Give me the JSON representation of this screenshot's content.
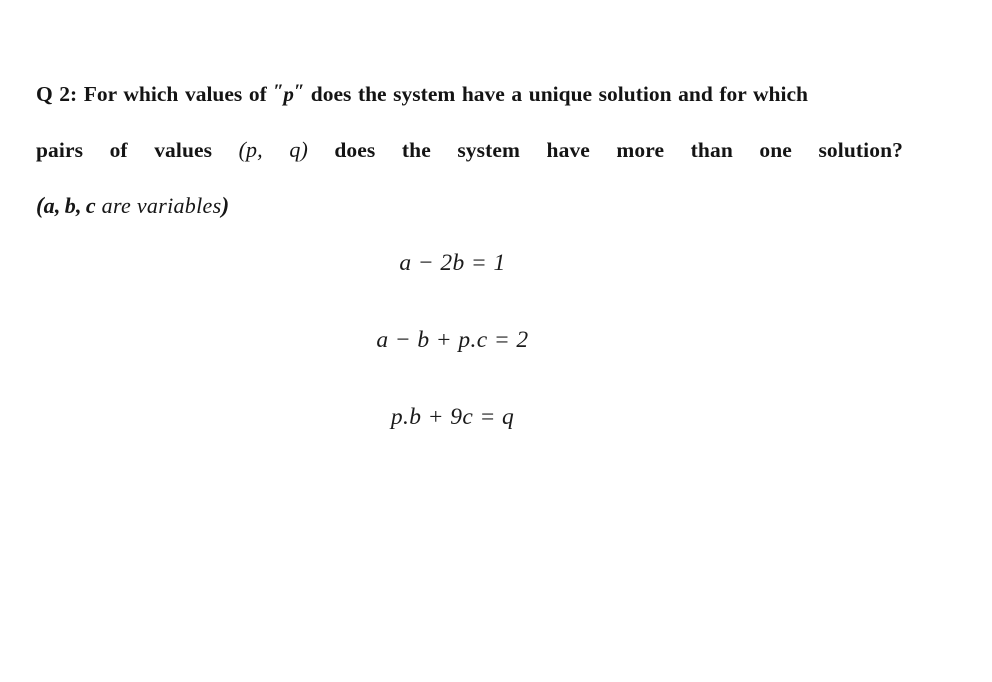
{
  "document": {
    "page_background": "#ffffff",
    "text_color": "#161616",
    "question_label": "Q 2:",
    "prose": {
      "line1_before_var": "For which values of",
      "line1_quoted_variable": "p",
      "line1_after_var": "does the system have a unique solution and for which",
      "line2_words": [
        "pairs",
        "of",
        "values"
      ],
      "line2_pair": "(p, q)",
      "line2_words_after": [
        "does",
        "the",
        "system",
        "have",
        "more",
        "than",
        "one",
        "solution?"
      ],
      "line2_full": "pairs of values (p, q) does the system have more than one solution?",
      "variables_note": {
        "open_paren": "(",
        "variables": [
          "a",
          "b",
          "c"
        ],
        "separator": ", ",
        "words": " are variables",
        "close_paren": ")",
        "full": "(a, b, c are variables)"
      }
    },
    "equations": [
      {
        "id": "eq1",
        "display": "a − 2b = 1",
        "lhs": "a − 2b",
        "rhs": "1",
        "terms": [
          {
            "coefficient": "1",
            "variable": "a",
            "sign": "+"
          },
          {
            "coefficient": "2",
            "variable": "b",
            "sign": "−"
          }
        ],
        "constant": "1"
      },
      {
        "id": "eq2",
        "display": "a − b + p.c = 2",
        "lhs": "a − b + p.c",
        "rhs": "2",
        "terms": [
          {
            "coefficient": "1",
            "variable": "a",
            "sign": "+"
          },
          {
            "coefficient": "1",
            "variable": "b",
            "sign": "−"
          },
          {
            "coefficient": "p",
            "variable": "c",
            "sign": "+"
          }
        ],
        "constant": "2"
      },
      {
        "id": "eq3",
        "display": "p.b + 9c = q",
        "lhs": "p.b + 9c",
        "rhs": "q",
        "terms": [
          {
            "coefficient": "p",
            "variable": "b",
            "sign": "+"
          },
          {
            "coefficient": "9",
            "variable": "c",
            "sign": "+"
          }
        ],
        "constant": "q"
      }
    ],
    "parameters": [
      "p",
      "q"
    ],
    "variables": [
      "a",
      "b",
      "c"
    ]
  }
}
